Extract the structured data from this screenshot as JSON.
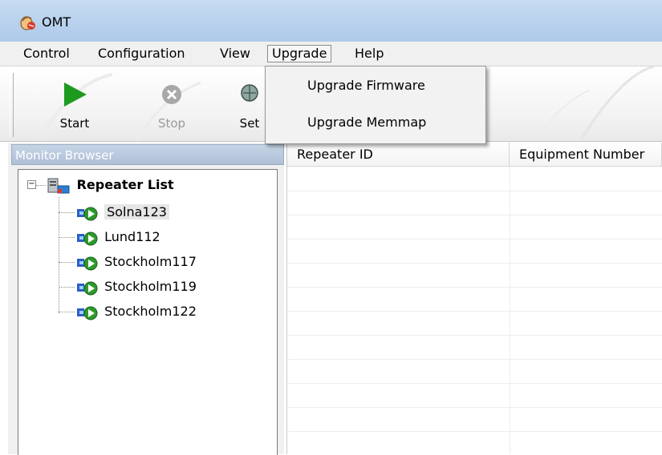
{
  "window": {
    "title": "OMT"
  },
  "menu": {
    "items": [
      {
        "label": "Control"
      },
      {
        "label": "Configuration"
      },
      {
        "label": "View"
      },
      {
        "label": "Upgrade"
      },
      {
        "label": "Help"
      }
    ],
    "open_menu": "Upgrade"
  },
  "toolbar": {
    "start_label": "Start",
    "stop_label": "Stop",
    "set_label": "Set"
  },
  "upgrade_menu": {
    "items": [
      {
        "label": "Upgrade Firmware"
      },
      {
        "label": "Upgrade Memmap"
      }
    ]
  },
  "monitor_browser": {
    "title": "Monitor Browser",
    "root_label": "Repeater List",
    "nodes": [
      {
        "label": "Solna123",
        "selected": true
      },
      {
        "label": "Lund112"
      },
      {
        "label": "Stockholm117"
      },
      {
        "label": "Stockholm119"
      },
      {
        "label": "Stockholm122"
      }
    ]
  },
  "grid": {
    "columns": [
      {
        "label": "Repeater ID"
      },
      {
        "label": "Equipment Number"
      }
    ]
  },
  "colors": {
    "title_bar": "#b7d0ec",
    "start_green": "#1e9a1e",
    "panel_header": "#aebfd7"
  }
}
